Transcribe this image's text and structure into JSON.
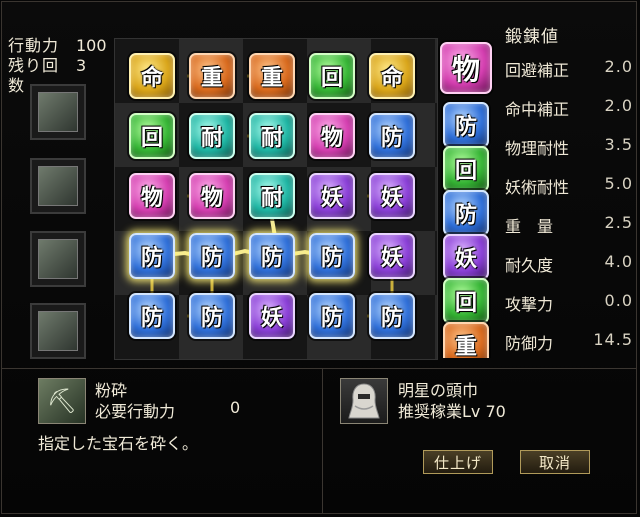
{
  "status": {
    "action_points_label": "行動力",
    "action_points_value": "100",
    "remaining_label": "残り回数",
    "remaining_value": "3"
  },
  "skills": [
    {
      "icon": "pickaxe-icon",
      "glyph": "⛏",
      "active": true
    },
    {
      "icon": "claw-icon",
      "glyph": "⟋",
      "active": false
    },
    {
      "icon": "claw-icon",
      "glyph": "⟋",
      "active": false
    },
    {
      "icon": "crosshair-flame-icon",
      "glyph": "✚",
      "active": false
    }
  ],
  "board": {
    "rows": [
      [
        {
          "t": "命",
          "c": "yellow"
        },
        {
          "t": "重",
          "c": "orange"
        },
        {
          "t": "重",
          "c": "orange"
        },
        {
          "t": "回",
          "c": "green"
        },
        {
          "t": "命",
          "c": "yellow"
        }
      ],
      [
        {
          "t": "回",
          "c": "green"
        },
        {
          "t": "耐",
          "c": "teal"
        },
        {
          "t": "耐",
          "c": "teal"
        },
        {
          "t": "物",
          "c": "pink"
        },
        {
          "t": "防",
          "c": "blue"
        }
      ],
      [
        {
          "t": "物",
          "c": "pink"
        },
        {
          "t": "物",
          "c": "pink"
        },
        {
          "t": "耐",
          "c": "teal"
        },
        {
          "t": "妖",
          "c": "purple"
        },
        {
          "t": "妖",
          "c": "purple"
        }
      ],
      [
        {
          "t": "防",
          "c": "blue",
          "lit": true
        },
        {
          "t": "防",
          "c": "blue",
          "lit": true
        },
        {
          "t": "防",
          "c": "blue",
          "lit": true
        },
        {
          "t": "防",
          "c": "blue",
          "lit": true
        },
        {
          "t": "妖",
          "c": "purple"
        }
      ],
      [
        {
          "t": "防",
          "c": "blue"
        },
        {
          "t": "防",
          "c": "blue"
        },
        {
          "t": "妖",
          "c": "purple"
        },
        {
          "t": "防",
          "c": "blue"
        },
        {
          "t": "防",
          "c": "blue"
        }
      ]
    ]
  },
  "queue": [
    {
      "t": "物",
      "c": "pink",
      "big": true
    },
    {
      "t": "防",
      "c": "blue"
    },
    {
      "t": "回",
      "c": "green"
    },
    {
      "t": "防",
      "c": "blue"
    },
    {
      "t": "妖",
      "c": "purple"
    },
    {
      "t": "回",
      "c": "green"
    },
    {
      "t": "重",
      "c": "orange"
    }
  ],
  "stats": {
    "title": "鍛錬値",
    "rows": [
      {
        "label": "回避補正",
        "value": "2.0"
      },
      {
        "label": "命中補正",
        "value": "2.0"
      },
      {
        "label": "物理耐性",
        "value": "3.5"
      },
      {
        "label": "妖術耐性",
        "value": "5.0"
      },
      {
        "label": "重　量",
        "value": "2.5"
      },
      {
        "label": "耐久度",
        "value": "4.0"
      },
      {
        "label": "攻撃力",
        "value": "0.0"
      },
      {
        "label": "防御力",
        "value": "14.5"
      }
    ]
  },
  "skill_info": {
    "name": "粉砕",
    "cost_label": "必要行動力",
    "cost_value": "0",
    "description": "指定した宝石を砕く。"
  },
  "item_info": {
    "name": "明星の頭巾",
    "recommend": "推奨稼業Lv 70"
  },
  "buttons": {
    "finish": "仕上げ",
    "cancel": "取消"
  },
  "colors": {
    "accent_gold": "#b09a5a",
    "highlight": "#ffe878"
  }
}
